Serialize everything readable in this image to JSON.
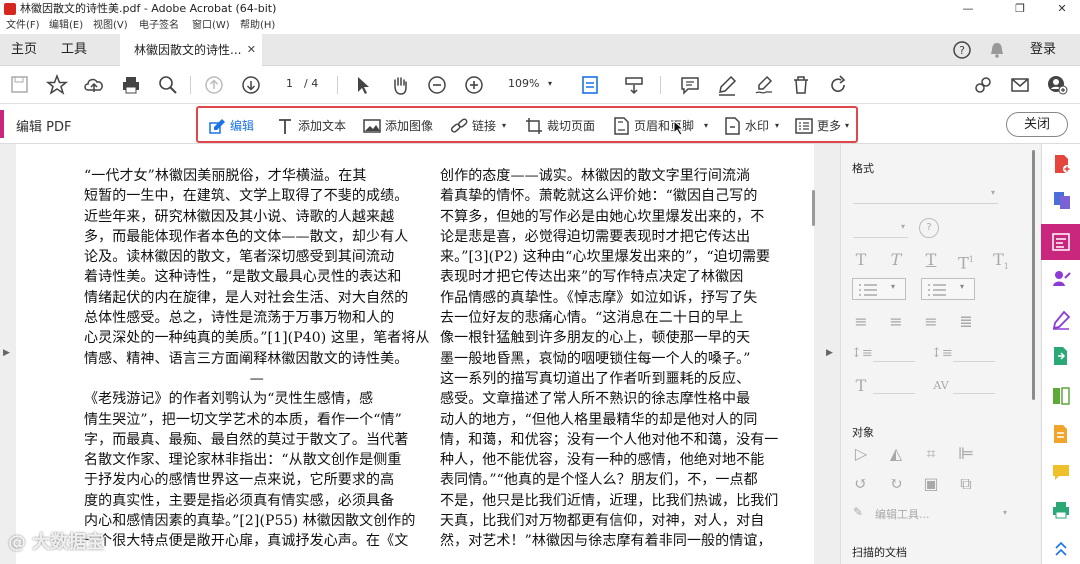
{
  "window": {
    "title": "林徽因散文的诗性美.pdf - Adobe Acrobat (64-bit)",
    "controls": [
      "—",
      "❐",
      "✕"
    ]
  },
  "menu": [
    "文件(F)",
    "编辑(E)",
    "视图(V)",
    "电子签名",
    "窗口(W)",
    "帮助(H)"
  ],
  "tabs": {
    "home": "主页",
    "tools": "工具",
    "document": "林徽因散文的诗性...",
    "close": "✕",
    "login": "登录"
  },
  "toolbar": {
    "page_current": "1",
    "page_total": "/ 4",
    "zoom": "109%"
  },
  "edit_bar": {
    "title": "编辑 PDF",
    "edit": "编辑",
    "add_text": "添加文本",
    "add_image": "添加图像",
    "link": "链接",
    "crop": "裁切页面",
    "header_footer": "页眉和页脚",
    "watermark": "水印",
    "more": "更多",
    "close": "关闭"
  },
  "document": {
    "left_column": [
      "“一代才女”林徽因美丽脱俗，才华横溢。在其",
      "短暂的一生中，在建筑、文学上取得了不斐的成绩。",
      "近些年来，研究林徽因及其小说、诗歌的人越来越",
      "多，而最能体现作者本色的文体——散文，却少有人",
      "论及。读林徽因的散文，笔者深切感受到其间流动",
      "着诗性美。这种诗性，“是散文最具心灵性的表达和",
      "情绪起伏的内在旋律，是人对社会生活、对大自然的",
      "总体性感受。总之，诗性是流荡于万事万物和人的",
      "心灵深处的一种纯真的美质。”[1](P40) 这里，笔者将从",
      "情感、精神、语言三方面阐释林徽因散文的诗性美。",
      "—",
      "《老残游记》的作者刘鹗认为“灵性生感情，感",
      "情生哭泣”，把一切文学艺术的本质，看作一个“情”",
      "字，而最真、最痴、最自然的莫过于散文了。当代著",
      "名散文作家、理论家林非指出：“从散文创作是侧重",
      "于抒发内心的感情世界这一点来说，它所要求的高",
      "度的真实性，主要是指必须真有情实感，必须具备",
      "内心和感情因素的真挚。”[2](P55) 林徽因散文创作的",
      "一个很大特点便是敞开心扉，真诚抒发心声。在《文"
    ],
    "right_column": [
      "创作的态度——诚实。林徽因的散文字里行间流淌",
      "着真挚的情怀。萧乾就这么评价她：“徽因自己写的",
      "不算多，但她的写作必是由她心坎里爆发出来的，不",
      "论是悲是喜，必觉得迫切需要表现时才把它传达出",
      "来。”[3](P2) 这种由“心坎里爆发出来的”，“迫切需要",
      "表现时才把它传达出来”的写作特点决定了林徽因",
      "作品情感的真挚性。《悼志摩》如泣如诉，抒写了失",
      "去一位好友的悲痛心情。“这消息在二十日的早上",
      "像一根针猛触到许多朋友的心上，顿使那一早的天",
      "墨一般地昏黑，哀恸的咽哽锁住每一个人的嗓子。”",
      "这一系列的描写真切道出了作者听到噩耗的反应、",
      "感受。文章描述了常人所不熟识的徐志摩性格中最",
      "动人的地方，“但他人格里最精华的却是他对人的同",
      "情，和蔼，和优容；没有一个人他对他不和蔼，没有一",
      "种人，他不能优容，没有一种的感情，他绝对地不能",
      "表同情。”“他真的是个怪人么？朋友们，不，一点都",
      "不是，他只是比我们近情，近理，比我们热诚，比我们",
      "天真，比我们对万物都更有信仰，对神，对人，对自",
      "然，对艺术！”林徽因与徐志摩有着非同一般的情谊，"
    ]
  },
  "panel": {
    "format": "格式",
    "object": "对象",
    "edit_tools": "编辑工具...",
    "scanned_doc": "扫描的文档"
  },
  "watermark_text": "@ 大数据宝",
  "colors": {
    "accent": "#c9267d",
    "highlight_border": "#e0474c",
    "acrobat_red": "#d7261e"
  }
}
